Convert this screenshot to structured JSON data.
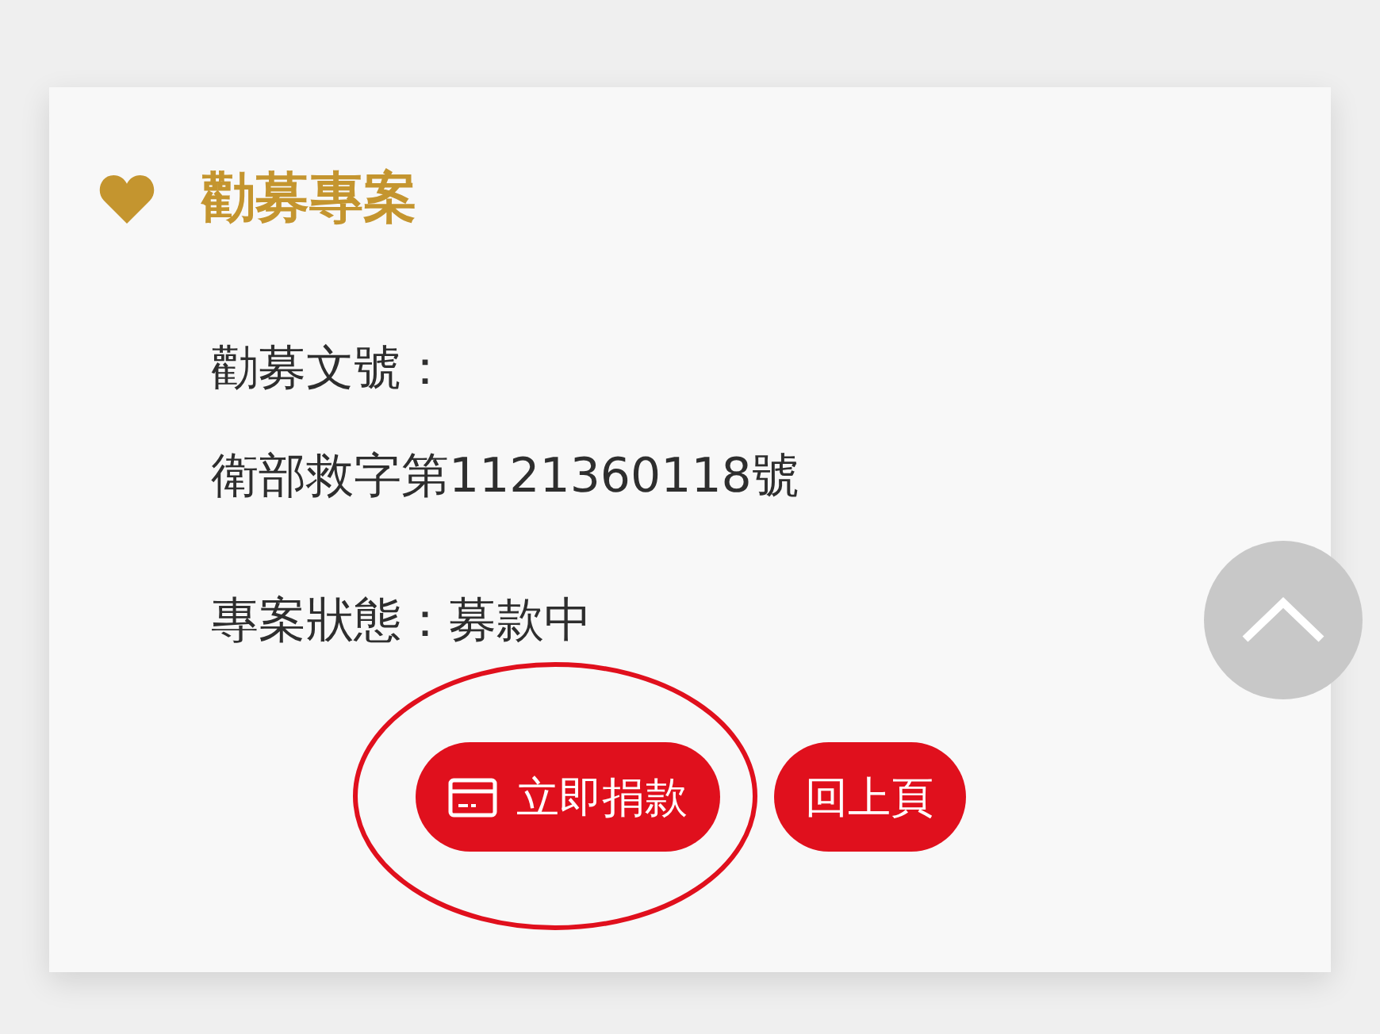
{
  "section": {
    "title": "勸募專案"
  },
  "fields": [
    {
      "text": "勸募文號："
    },
    {
      "text": "衛部救字第1121360118號"
    },
    {
      "text": "專案狀態：募款中"
    }
  ],
  "buttons": [
    {
      "label": "立即捐款",
      "kind": "donate",
      "circled": true
    },
    {
      "label": "回上頁",
      "kind": "back",
      "circled": false
    }
  ]
}
